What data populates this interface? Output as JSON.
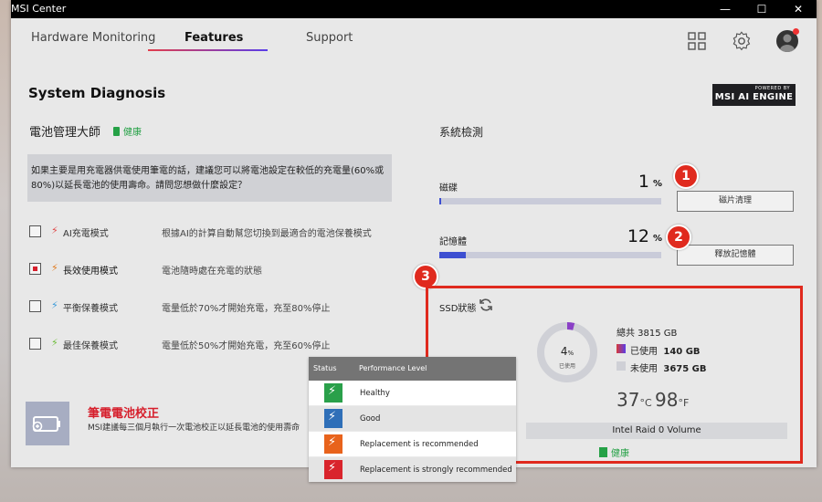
{
  "app": {
    "title": "MSI Center"
  },
  "window_controls": {
    "minimize": "—",
    "maximize": "☐",
    "close": "✕"
  },
  "nav": {
    "tabs": [
      "Hardware Monitoring",
      "Features",
      "Support"
    ],
    "active": "Features"
  },
  "page": {
    "title": "System Diagnosis",
    "ai_badge_small": "POWERED BY",
    "ai_badge_main": "MSI AI ENGINE"
  },
  "battery": {
    "title": "電池管理大師",
    "status": "健康",
    "question_line1": "如果主要是用充電器供電使用筆電的話，建議您可以將電池設定在較低的充電量(60%或",
    "question_line2": "80%)以延長電池的使用壽命。請問您想做什麼設定？",
    "modes": [
      {
        "label": "AI充電模式",
        "desc": "根據AI的計算自動幫您切換到最適合的電池保養模式",
        "checked": false,
        "bolt_color": "#e04848"
      },
      {
        "label": "長效使用模式",
        "desc": "電池隨時處在充電的狀態",
        "checked": true,
        "bolt_color": "#e07a1e"
      },
      {
        "label": "平衡保養模式",
        "desc": "電量低於70%才開始充電，充至80%停止",
        "checked": false,
        "bolt_color": "#3a9ad9"
      },
      {
        "label": "最佳保養模式",
        "desc": "電量低於50%才開始充電，充至60%停止",
        "checked": false,
        "bolt_color": "#6dbd3a"
      }
    ],
    "calibration_title": "筆電電池校正",
    "calibration_desc": "MSI建議每三個月執行一次電池校正以延長電池的使用壽命"
  },
  "system_check": {
    "title": "系統檢測",
    "disk": {
      "label": "磁碟",
      "value": "1",
      "unit": "%",
      "button": "磁片清理",
      "fraction": 0.01
    },
    "memory": {
      "label": "記憶體",
      "value": "12",
      "unit": "%",
      "button": "釋放記憶體",
      "fraction": 0.12
    },
    "markers": [
      "1",
      "2",
      "3"
    ]
  },
  "ssd": {
    "title": "SSD狀態",
    "used_percent": "4",
    "used_percent_unit": "%",
    "used_label": "已使用",
    "total": "總共 3815 GB",
    "used_legend_label": "已使用",
    "used_legend_value": "140 GB",
    "free_legend_label": "未使用",
    "free_legend_value": "3675 GB",
    "temp_c": "37",
    "temp_c_unit": "°C",
    "temp_f": "98",
    "temp_f_unit": "°F",
    "volume": "Intel Raid 0 Volume",
    "health": "健康",
    "used_fraction": 0.04
  },
  "status_table": {
    "headers": [
      "Status",
      "Performance Level"
    ],
    "rows": [
      {
        "level": "Healthy",
        "color": "#2aa04a"
      },
      {
        "level": "Good",
        "color": "#2f6fb8"
      },
      {
        "level": "Replacement is recommended",
        "color": "#e8631c"
      },
      {
        "level": "Replacement is strongly recommended",
        "color": "#d9242c"
      }
    ]
  },
  "colors": {
    "accent_red": "#e02a1e",
    "health_green": "#25a146",
    "bar_blue": "#3d4fd1"
  }
}
